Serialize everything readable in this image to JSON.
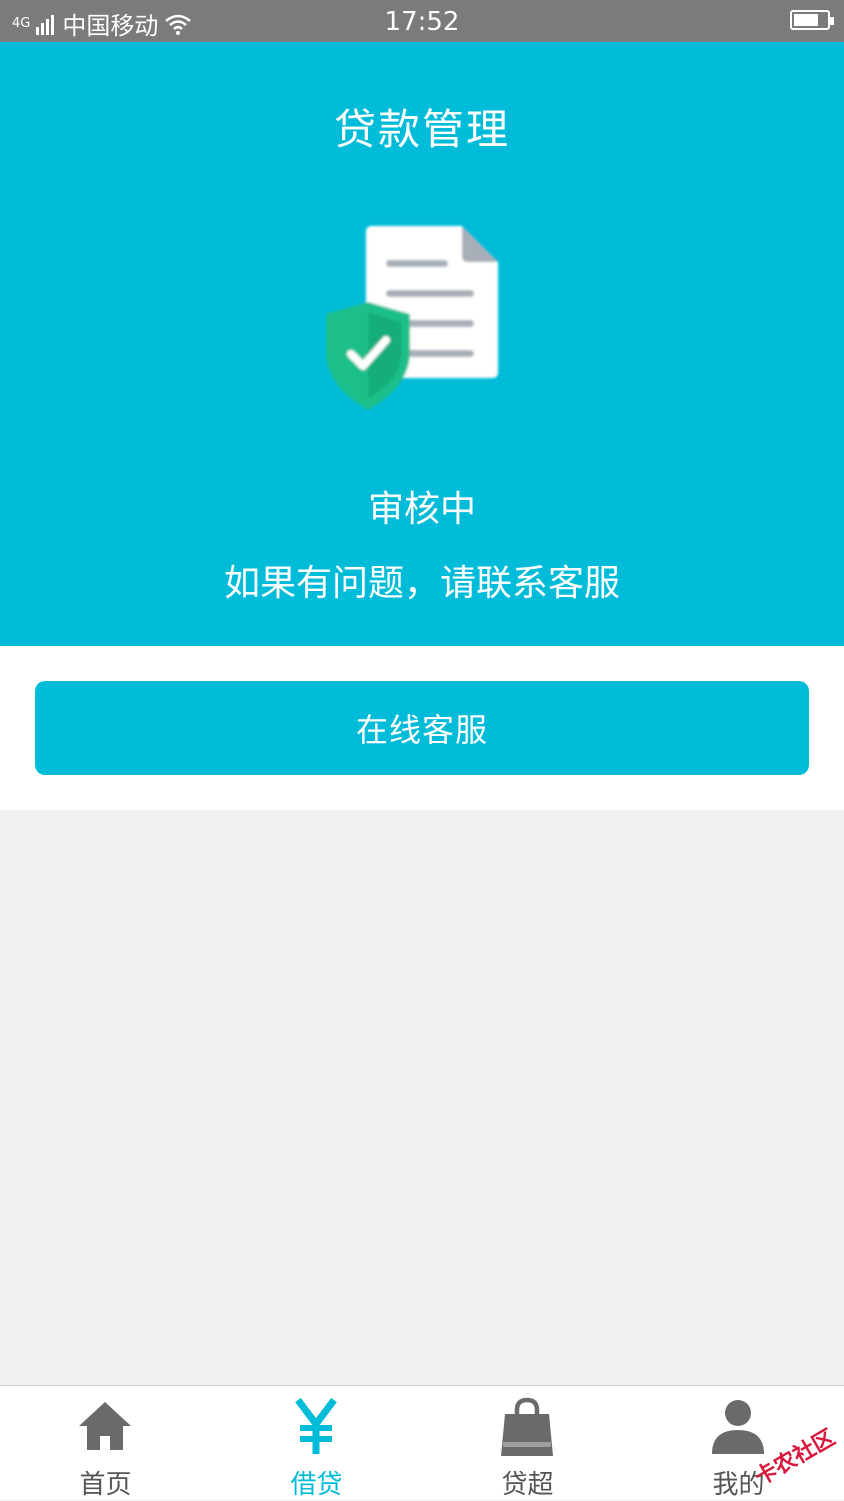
{
  "status_bar": {
    "signal": "4G",
    "carrier": "中国移动",
    "time": "17:52"
  },
  "header": {
    "title": "贷款管理"
  },
  "loan_status": {
    "status": "审核中",
    "hint": "如果有问题，请联系客服"
  },
  "actions": {
    "online_service_label": "在线客服"
  },
  "tabbar": {
    "active_index": 1,
    "active_color": "#00bcd8",
    "items": [
      {
        "label": "首页",
        "icon": "home-icon"
      },
      {
        "label": "借贷",
        "icon": "yen-icon"
      },
      {
        "label": "贷超",
        "icon": "shopping-bag-icon"
      },
      {
        "label": "我的",
        "icon": "user-icon"
      }
    ]
  },
  "watermark": {
    "text": "卡农社区"
  },
  "colors": {
    "brand": "#00bcd8",
    "shield": "#1fbf8a",
    "status_bar": "#7b7b7b",
    "background": "#f1f1f1"
  }
}
